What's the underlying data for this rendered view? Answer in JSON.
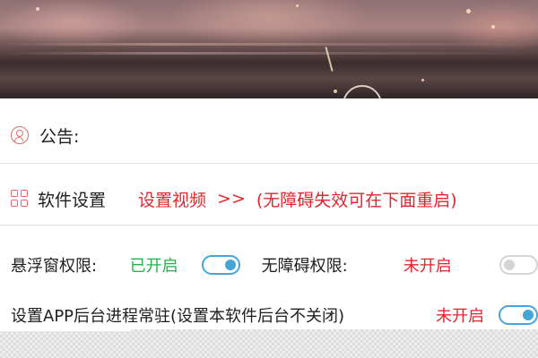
{
  "notice": {
    "label": "公告:"
  },
  "settings": {
    "label": "软件设置",
    "video_link": "设置视频",
    "arrow": ">>",
    "hint": "(无障碍失效可在下面重启)"
  },
  "permissions": {
    "overlay_label": "悬浮窗权限:",
    "overlay_status": "已开启",
    "overlay_enabled": true,
    "accessibility_label": "无障碍权限:",
    "accessibility_status": "未开启",
    "accessibility_enabled": false
  },
  "resident": {
    "label": "设置APP后台进程常驻(设置本软件后台不关闭)",
    "status": "未开启"
  },
  "colors": {
    "accent_red": "#e0262c",
    "enabled_green": "#22b34a",
    "toggle_blue": "#45a5d8",
    "icon_red": "#e06a6a"
  },
  "icons": {
    "notice": "person-circle-icon",
    "settings": "grid-icon"
  }
}
